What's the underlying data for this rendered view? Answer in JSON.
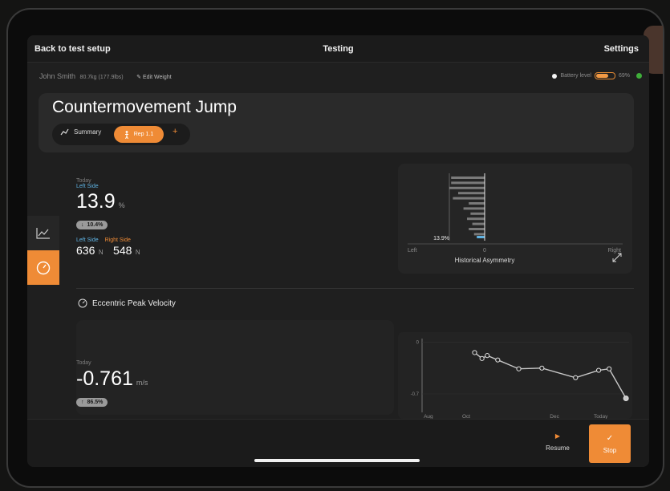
{
  "topbar": {
    "back_label": "Back to test setup",
    "title": "Testing",
    "settings_label": "Settings"
  },
  "user": {
    "name": "John Smith",
    "weight": "80.7kg (177.9lbs)",
    "edit_label": "Edit Weight"
  },
  "battery": {
    "label": "Battery level",
    "percent_text": "69%",
    "level": 0.69,
    "status_color": "#3fae3a"
  },
  "test": {
    "title": "Countermovement Jump"
  },
  "tabs": {
    "summary_label": "Summary",
    "rep_label": "Rep 1.1",
    "add_label": "+"
  },
  "asymmetry": {
    "today_label": "Today",
    "side_label": "Left Side",
    "value": "13.9",
    "unit": "%",
    "change": "10.4%",
    "left_label": "Left Side",
    "right_label": "Right Side",
    "left_value": "636",
    "right_value": "548",
    "force_unit": "N"
  },
  "eccentric": {
    "title": "Eccentric Peak Velocity",
    "today_label": "Today",
    "value": "-0.761",
    "unit": "m/s",
    "change": "86.5%"
  },
  "chart_data": [
    {
      "type": "bar",
      "title": "Historical Asymmetry",
      "xlabel": "",
      "ylabel": "",
      "orientation": "horizontal",
      "xlim": [
        -20,
        20
      ],
      "x_tick_labels": [
        "Left",
        "0",
        "Right"
      ],
      "values": [
        -19,
        -19,
        -20,
        -15,
        -18,
        -9,
        -12,
        -8,
        -10,
        -7,
        -9,
        -6
      ],
      "highlight": {
        "value": 13.9,
        "label": "13.9%"
      },
      "colors": {
        "bars": "#7a7a7a",
        "highlight": "#5fb3e3"
      }
    },
    {
      "type": "line",
      "title": "",
      "y_tick_labels": [
        "0",
        "-0.7"
      ],
      "x_tick_labels": [
        "Aug",
        "Oct",
        "Dec",
        "Today"
      ],
      "ylim": [
        -0.95,
        0.05
      ],
      "x": [
        0.25,
        0.285,
        0.31,
        0.36,
        0.46,
        0.57,
        0.73,
        0.84,
        0.89,
        0.97
      ],
      "values": [
        -0.14,
        -0.22,
        -0.18,
        -0.24,
        -0.36,
        -0.35,
        -0.48,
        -0.38,
        -0.36,
        -0.76
      ],
      "colors": {
        "line": "#c8c8c8"
      }
    }
  ],
  "actions": {
    "resume_label": "Resume",
    "stop_label": "Stop"
  }
}
